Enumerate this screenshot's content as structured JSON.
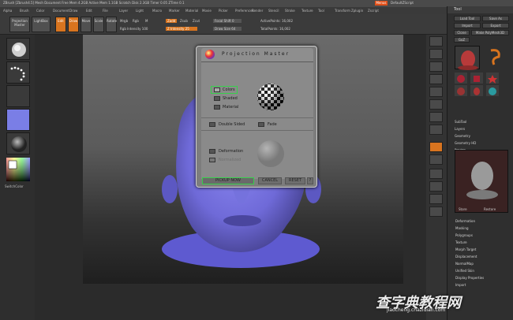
{
  "titlebar": {
    "title": "ZBrush  [Zbrush4.5]  Mesh Document  Free Mem 4.2GB  Active Mem 1.1GB  Scratch Disk 2.3GB  Timer 0.05  ZTime 0.1",
    "highlight": "Menus",
    "right": "DefaultZScript"
  },
  "menubar": {
    "items": [
      "Alpha",
      "Brush",
      "Color",
      "Document",
      "Draw",
      "Edit",
      "File",
      "Layer",
      "Light",
      "Macro",
      "Marker",
      "Material",
      "Movie",
      "Picker",
      "Preferences",
      "Render",
      "Stencil",
      "Stroke",
      "Texture",
      "Tool",
      "Transform",
      "Zplugin",
      "Zscript"
    ]
  },
  "toolbar": {
    "projection_master": "Projection Master",
    "lightbox": "LightBox",
    "edit": "Edit",
    "draw": "Draw",
    "move": "Move",
    "scale": "Scale",
    "rotate": "Rotate",
    "mrgb": "Mrgb",
    "rgb": "Rgb",
    "m": "M",
    "rgb_intensity": "Rgb Intensity 100",
    "zadd": "Zadd",
    "zsub": "Zsub",
    "zcut": "Zcut",
    "z_intensity": "Z Intensity 25",
    "focal_shift": "Focal Shift 0",
    "draw_size": "Draw Size 64",
    "active_points": "ActivePoints: 16,002",
    "total_points": "TotalPoints: 16,002"
  },
  "leftpanel": {
    "colors_label": "SwitchColor",
    "gradient_label": "Gradient"
  },
  "projection_master": {
    "title": "Projection Master",
    "colors": "Colors",
    "shaded": "Shaded",
    "material": "Material",
    "double_sided": "Double Sided",
    "fade": "Fade",
    "deformation": "Deformation",
    "normalized": "Normalized",
    "pickup_now": "PICKUP NOW",
    "cancel": "CANCEL",
    "reset": "RESET",
    "help": "?"
  },
  "rightpanel": {
    "header": "Tool",
    "load_tool": "Load Tool",
    "save_as": "Save As",
    "import": "Import",
    "export": "Export",
    "clone": "Clone",
    "make_polymesh": "Make PolyMesh3D",
    "goz": "GoZ",
    "sections": [
      "SubTool",
      "Layers",
      "Geometry",
      "Geometry HD",
      "Preview"
    ],
    "preview_store": "Store",
    "preview_restore": "Restore",
    "items": [
      "Deformation",
      "Masking",
      "Polygroups",
      "Texture",
      "Morph Target",
      "Displacement",
      "NormalMap",
      "Unified Skin",
      "Display Properties",
      "Import"
    ]
  },
  "watermark": {
    "text": "查字典教程网",
    "url": "jiaocheng.chazidian.com"
  },
  "colors": {
    "accent": "#d8741f",
    "model": "#6f6fdc",
    "highlight_green": "#36d04a"
  }
}
